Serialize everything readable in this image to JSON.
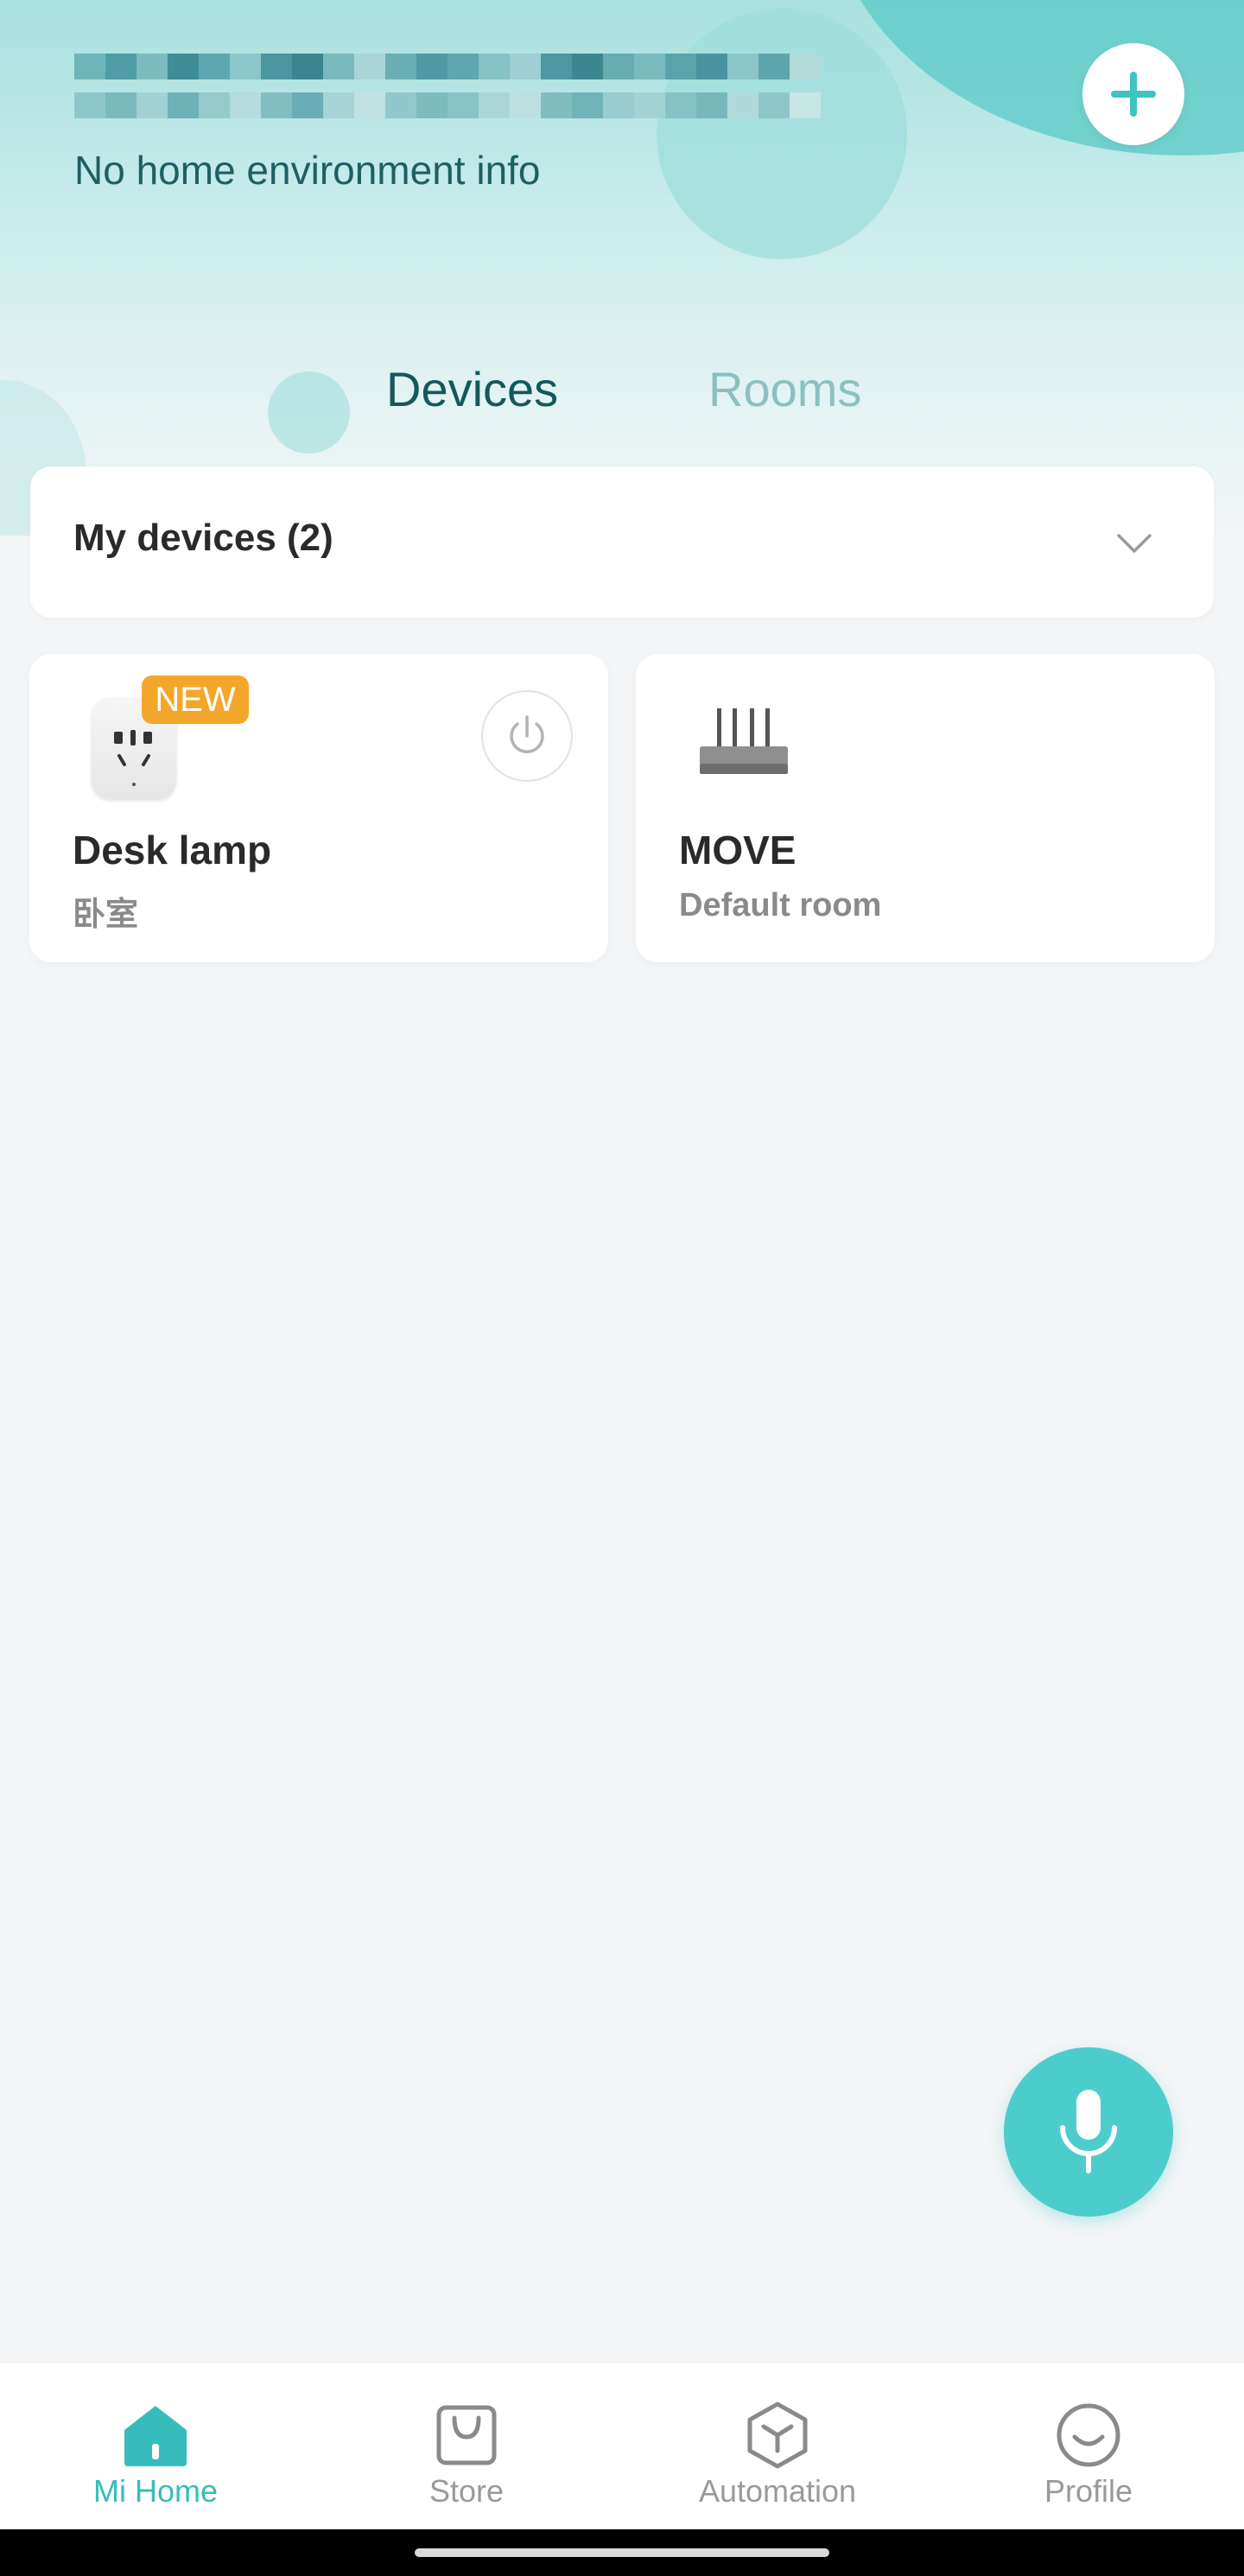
{
  "header": {
    "env_info": "No home environment info",
    "add_button_icon": "plus-icon"
  },
  "tabs": [
    {
      "label": "Devices",
      "active": true
    },
    {
      "label": "Rooms",
      "active": false
    }
  ],
  "device_group": {
    "label": "My devices (2)",
    "icon": "chevron-down-icon"
  },
  "devices": [
    {
      "name": "Desk lamp",
      "room": "卧室",
      "badge": "NEW",
      "icon": "smart-plug-icon",
      "control_icon": "power-icon"
    },
    {
      "name": "MOVE",
      "room": "Default room",
      "icon": "router-icon"
    }
  ],
  "voice_button": {
    "icon": "microphone-icon"
  },
  "bottom_nav": [
    {
      "label": "Mi Home",
      "icon": "home-icon",
      "active": true
    },
    {
      "label": "Store",
      "icon": "store-bag-icon",
      "active": false
    },
    {
      "label": "Automation",
      "icon": "automation-cube-icon",
      "active": false
    },
    {
      "label": "Profile",
      "icon": "profile-smile-icon",
      "active": false
    }
  ],
  "colors": {
    "accent": "#4ccdcc",
    "active_tab": "#15585c",
    "inactive_tab": "#8cbfc0",
    "badge": "#f3a72a"
  }
}
